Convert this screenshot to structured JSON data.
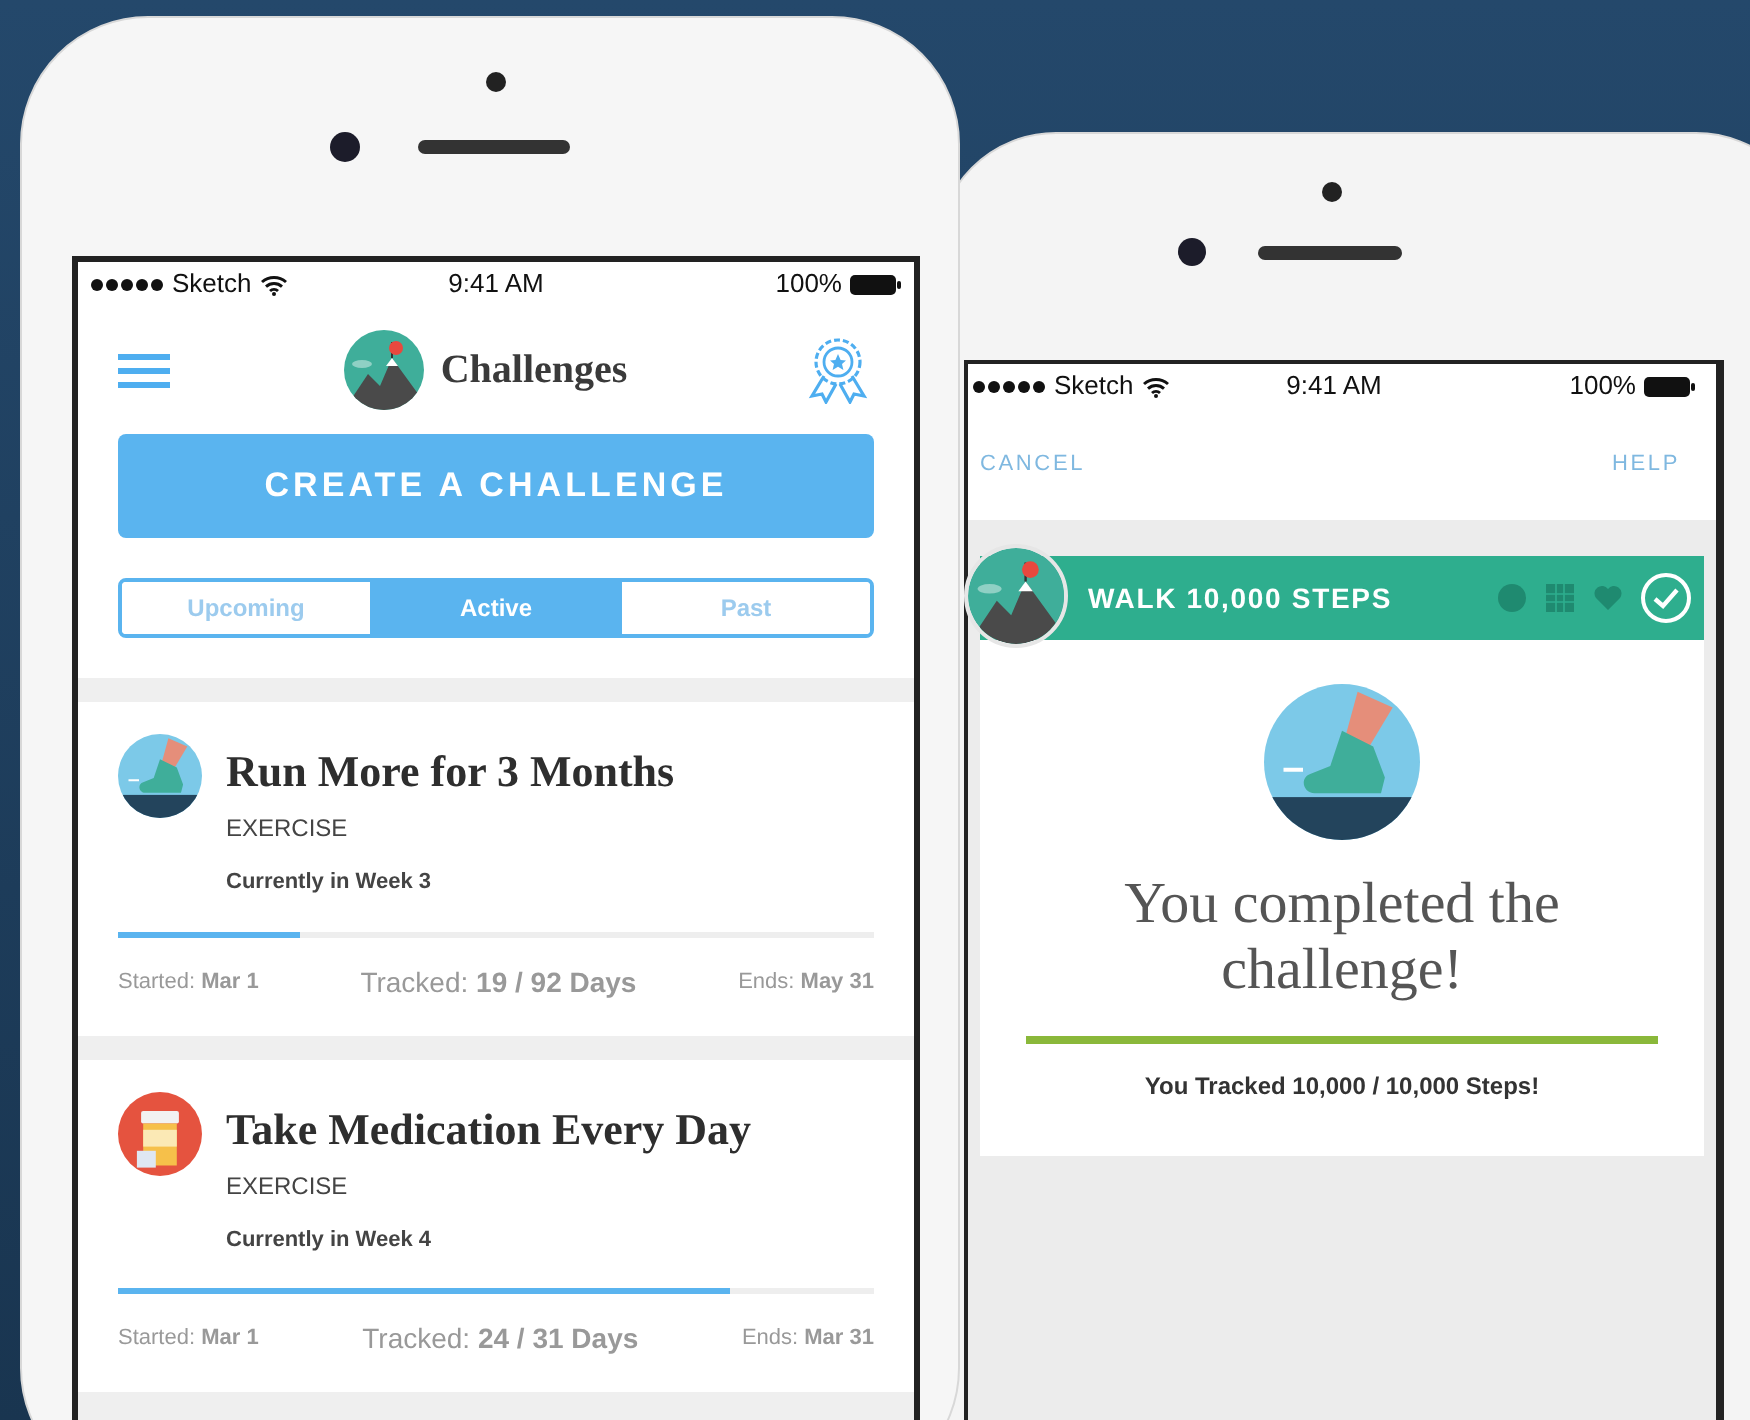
{
  "left_phone": {
    "status_bar": {
      "carrier": "Sketch",
      "time": "9:41 AM",
      "battery": "100%"
    },
    "header": {
      "title": "Challenges"
    },
    "create_button": "CREATE A CHALLENGE",
    "segments": [
      {
        "label": "Upcoming",
        "selected": false
      },
      {
        "label": "Active",
        "selected": true
      },
      {
        "label": "Past",
        "selected": false
      }
    ],
    "challenges": [
      {
        "kind": "shoe",
        "title": "Run More for 3 Months",
        "category": "EXERCISE",
        "week": "Currently in Week 3",
        "level": 0.24,
        "started": "Started: **Mar 1**",
        "tracked": "Tracked: **19 / 92 Days**",
        "ends": "Ends: **May 31**"
      },
      {
        "kind": "medication",
        "title": "Take Medication Every Day",
        "category": "EXERCISE",
        "week": "Currently in Week 4",
        "level": 0.81,
        "started": "Started: **Mar 1**",
        "tracked": "Tracked: **24 / 31 Days**",
        "ends": "Ends: **Mar 31**"
      }
    ]
  },
  "right_phone": {
    "status_bar": {
      "carrier": "Sketch",
      "time": "9:41 AM",
      "battery": "100%"
    },
    "nav": {
      "cancel": "CANCEL",
      "help": "HELP"
    },
    "card": {
      "title": "WALK 10,000 STEPS",
      "completed": true,
      "message": "You completed the challenge!",
      "level": 1,
      "summary": "You Tracked 10,000 / 10,000 Steps!"
    }
  }
}
